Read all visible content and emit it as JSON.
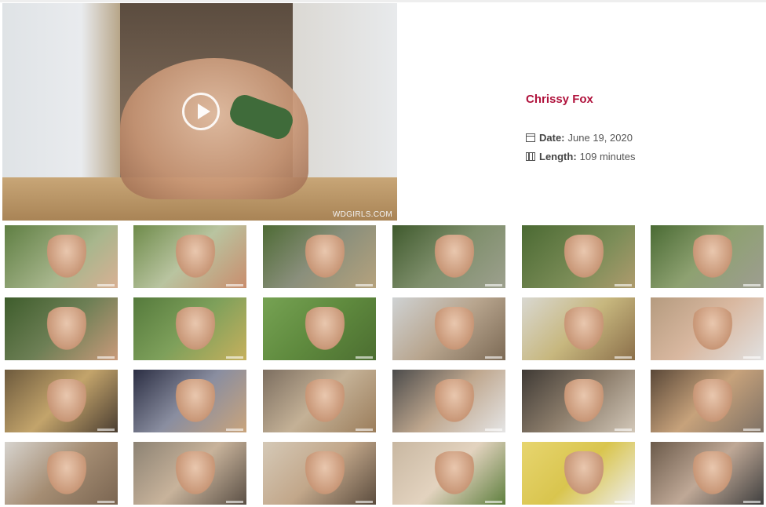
{
  "video": {
    "watermark": "WDGIRLS.COM",
    "play_icon": "play-circle-icon"
  },
  "scene": {
    "model_name": "Chrissy Fox",
    "date_label": "Date:",
    "date_value": "June 19, 2020",
    "length_label": "Length:",
    "length_value": "109 minutes",
    "date_icon": "calendar-icon",
    "length_icon": "film-icon"
  },
  "thumbnails": [
    {
      "bg": "linear-gradient(135deg,#5f7f43,#a8b68d 60%,#d8b093)"
    },
    {
      "bg": "linear-gradient(135deg,#6e8b4a,#b9c4a0 50%,#c98d6d)"
    },
    {
      "bg": "linear-gradient(135deg,#4e6b35,#8a8f7c 50%,#b5a27d)"
    },
    {
      "bg": "linear-gradient(135deg,#3f5a2d,#7f8f6c 50%,#9da08e)"
    },
    {
      "bg": "linear-gradient(135deg,#4b6a33,#7c8d58 60%,#ae9b6d)"
    },
    {
      "bg": "linear-gradient(135deg,#4a6b34,#8ea171 50%,#9e9d91)"
    },
    {
      "bg": "linear-gradient(135deg,#3e5d2c,#6d7f55 50%,#c99a7a)"
    },
    {
      "bg": "linear-gradient(135deg,#557a3c,#7ea05b 50%,#c6b05d)"
    },
    {
      "bg": "linear-gradient(135deg,#76a253,#5f8a3e 50%,#4c6e31)"
    },
    {
      "bg": "linear-gradient(135deg,#cfd2d3,#b8a58e 50%,#7c6a55)"
    },
    {
      "bg": "linear-gradient(135deg,#d9d8d1,#c7b77e 50%,#8b6f4a)"
    },
    {
      "bg": "linear-gradient(135deg,#b59b7f,#d9b8a0 50%,#e1e1e1)"
    },
    {
      "bg": "linear-gradient(135deg,#6d5a3d,#c3a46b 50%,#4a3d31)"
    },
    {
      "bg": "linear-gradient(135deg,#2b2e43,#8a8ea0 50%,#c9a47c)"
    },
    {
      "bg": "linear-gradient(135deg,#7c6e60,#c4b196 50%,#9b7d5b)"
    },
    {
      "bg": "linear-gradient(135deg,#4b4b4b,#bfa78e 50%,#e5e5e5)"
    },
    {
      "bg": "linear-gradient(135deg,#3f3a35,#8c7d6b 50%,#d2c7b8)"
    },
    {
      "bg": "linear-gradient(135deg,#5a4838,#c7a27b 50%,#7e7165)"
    },
    {
      "bg": "linear-gradient(135deg,#d7d4cf,#a58d73 50%,#7a6551)"
    },
    {
      "bg": "linear-gradient(135deg,#8c8273,#c8b39b 50%,#5a4f45)"
    },
    {
      "bg": "linear-gradient(135deg,#d5c9b7,#c2a78a 50%,#5b4c3e)"
    },
    {
      "bg": "linear-gradient(135deg,#c8b7a1,#e3d3bf 50%,#5e7f3e)"
    },
    {
      "bg": "linear-gradient(135deg,#e7d56f,#d9c54e 50%,#eeeeee)"
    },
    {
      "bg": "linear-gradient(135deg,#6b5a4a,#bfa896 50%,#3e3e3e)"
    }
  ]
}
